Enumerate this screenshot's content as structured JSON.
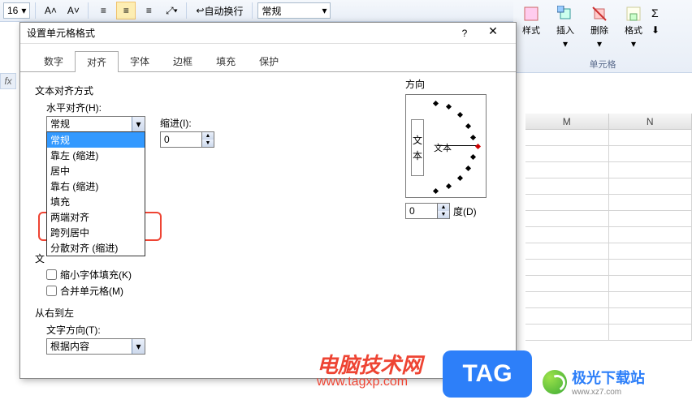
{
  "ribbon": {
    "fontsize": "16",
    "wrap_text": "自动换行",
    "number_format": "常规",
    "style_label": "样式",
    "insert": "插入",
    "delete": "删除",
    "format": "格式",
    "cells_group": "单元格",
    "sigma": "Σ"
  },
  "fx": "fx",
  "grid": {
    "cols": [
      "M",
      "N"
    ]
  },
  "dialog": {
    "title": "设置单元格格式",
    "help": "?",
    "close": "✕",
    "tabs": [
      "数字",
      "对齐",
      "字体",
      "边框",
      "填充",
      "保护"
    ],
    "active_tab": 1,
    "text_align_label": "文本对齐方式",
    "h_align_label": "水平对齐(H):",
    "h_align_value": "常规",
    "h_align_options": [
      "常规",
      "靠左 (缩进)",
      "居中",
      "靠右 (缩进)",
      "填充",
      "两端对齐",
      "跨列居中",
      "分散对齐 (缩进)"
    ],
    "indent_label": "缩进(I):",
    "indent_value": "0",
    "text_control_hidden": "文",
    "shrink": "缩小字体填充(K)",
    "merge": "合并单元格(M)",
    "rtl_label": "从右到左",
    "text_dir_label": "文字方向(T):",
    "text_dir_value": "根据内容",
    "orient_label": "方向",
    "orient_v_text": "文本",
    "orient_h_text": "文本",
    "degree_value": "0",
    "degree_label": "度(D)"
  },
  "watermark": {
    "title": "电脑技术网",
    "url": "www.tagxp.com",
    "tag": "TAG",
    "jg_name": "极光下载站",
    "jg_url": "www.xz7.com"
  }
}
